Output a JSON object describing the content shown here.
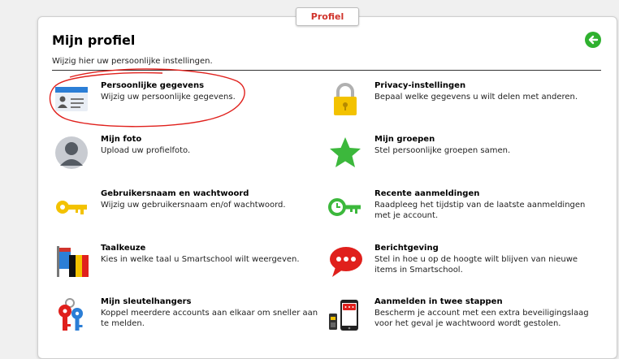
{
  "tab_label": "Profiel",
  "page": {
    "title": "Mijn profiel",
    "subtitle": "Wijzig hier uw persoonlijke instellingen."
  },
  "items": [
    {
      "title": "Persoonlijke gegevens",
      "desc": "Wijzig uw persoonlijke gegevens.",
      "icon": "id-card-icon"
    },
    {
      "title": "Privacy-instellingen",
      "desc": "Bepaal welke gegevens u wilt delen met anderen.",
      "icon": "padlock-icon"
    },
    {
      "title": "Mijn foto",
      "desc": "Upload uw profielfoto.",
      "icon": "profile-photo-icon"
    },
    {
      "title": "Mijn groepen",
      "desc": "Stel persoonlijke groepen samen.",
      "icon": "star-icon"
    },
    {
      "title": "Gebruikersnaam en wachtwoord",
      "desc": "Wijzig uw gebruikersnaam en/of wachtwoord.",
      "icon": "key-icon"
    },
    {
      "title": "Recente aanmeldingen",
      "desc": "Raadpleeg het tijdstip van de laatste aanmeldingen met je account.",
      "icon": "clock-key-icon"
    },
    {
      "title": "Taalkeuze",
      "desc": "Kies in welke taal u Smartschool wilt weergeven.",
      "icon": "flags-icon"
    },
    {
      "title": "Berichtgeving",
      "desc": "Stel in hoe u op de hoogte wilt blijven van nieuwe items in Smartschool.",
      "icon": "speech-bubble-icon"
    },
    {
      "title": "Mijn sleutelhangers",
      "desc": "Koppel meerdere accounts aan elkaar om sneller aan te melden.",
      "icon": "keychain-icon"
    },
    {
      "title": "Aanmelden in twee stappen",
      "desc": "Bescherm je account met een extra beveiligingslaag voor het geval je wachtwoord wordt gestolen.",
      "icon": "phone-token-icon"
    }
  ],
  "colors": {
    "accent_red": "#d0342c",
    "back_green": "#2fb12f",
    "icon_blue": "#2b7ed6",
    "icon_yellow": "#f3c200",
    "icon_green": "#3cb83c",
    "annotation_red": "#e0201c"
  }
}
